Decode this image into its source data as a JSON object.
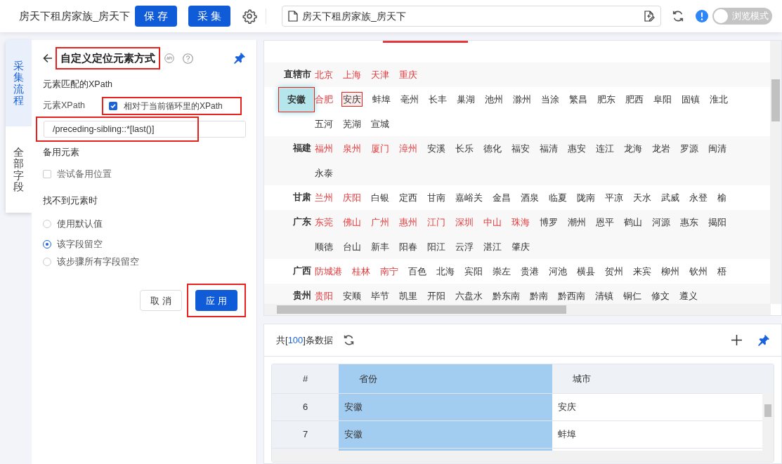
{
  "toolbar": {
    "task_name": "房天下租房家族_房天下",
    "buttons": [
      "保 存",
      "采 集"
    ],
    "url": "房天下租房家族_房天下",
    "mode_toggle": {
      "label": "浏览模式",
      "on": false
    }
  },
  "side_tabs": [
    {
      "label": "采集流程",
      "selected": true
    },
    {
      "label": "全部字段",
      "selected": false
    }
  ],
  "panel": {
    "title": "自定义定位元素方式",
    "xpath_section": "元素匹配的XPath",
    "xpath_label": "元素XPath",
    "relative": {
      "label": "相对于当前循环里的XPath",
      "checked": true
    },
    "xpath_value": "/preceding-sibling::*[last()]",
    "backup_section": "备用元素",
    "backup": {
      "label": "尝试备用位置",
      "checked": false
    },
    "missing_section": "找不到元素时",
    "missing_options": [
      {
        "label": "使用默认值",
        "selected": false
      },
      {
        "label": "该字段留空",
        "selected": true
      },
      {
        "label": "该步骤所有字段留空",
        "selected": false
      }
    ],
    "buttons": [
      "取 消",
      "应 用"
    ]
  },
  "provinces": [
    {
      "name": "直辖市",
      "selected": false,
      "lines": [
        [
          {
            "name": "北京",
            "hot": true,
            "selected": false
          },
          {
            "name": "上海",
            "hot": true,
            "selected": false
          },
          {
            "name": "天津",
            "hot": true,
            "selected": false
          },
          {
            "name": "重庆",
            "hot": true,
            "selected": false
          }
        ]
      ]
    },
    {
      "name": "安徽",
      "selected": true,
      "lines": [
        [
          {
            "name": "合肥",
            "hot": true,
            "selected": false
          },
          {
            "name": "安庆",
            "hot": false,
            "selected": true
          },
          {
            "name": "蚌埠",
            "hot": false,
            "selected": false
          },
          {
            "name": "亳州",
            "hot": false,
            "selected": false
          },
          {
            "name": "长丰",
            "hot": false,
            "selected": false
          },
          {
            "name": "巢湖",
            "hot": false,
            "selected": false
          },
          {
            "name": "池州",
            "hot": false,
            "selected": false
          },
          {
            "name": "滁州",
            "hot": false,
            "selected": false
          },
          {
            "name": "当涂",
            "hot": false,
            "selected": false
          },
          {
            "name": "繁昌",
            "hot": false,
            "selected": false
          },
          {
            "name": "肥东",
            "hot": false,
            "selected": false
          },
          {
            "name": "肥西",
            "hot": false,
            "selected": false
          },
          {
            "name": "阜阳",
            "hot": false,
            "selected": false
          },
          {
            "name": "固镇",
            "hot": false,
            "selected": false
          },
          {
            "name": "淮北",
            "hot": false,
            "selected": false
          }
        ],
        [
          {
            "name": "五河",
            "hot": false,
            "selected": false
          },
          {
            "name": "芜湖",
            "hot": false,
            "selected": false
          },
          {
            "name": "宣城",
            "hot": false,
            "selected": false
          }
        ]
      ]
    },
    {
      "name": "福建",
      "selected": false,
      "lines": [
        [
          {
            "name": "福州",
            "hot": true,
            "selected": false
          },
          {
            "name": "泉州",
            "hot": true,
            "selected": false
          },
          {
            "name": "厦门",
            "hot": true,
            "selected": false
          },
          {
            "name": "漳州",
            "hot": true,
            "selected": false
          },
          {
            "name": "安溪",
            "hot": false,
            "selected": false
          },
          {
            "name": "长乐",
            "hot": false,
            "selected": false
          },
          {
            "name": "德化",
            "hot": false,
            "selected": false
          },
          {
            "name": "福安",
            "hot": false,
            "selected": false
          },
          {
            "name": "福清",
            "hot": false,
            "selected": false
          },
          {
            "name": "惠安",
            "hot": false,
            "selected": false
          },
          {
            "name": "连江",
            "hot": false,
            "selected": false
          },
          {
            "name": "龙海",
            "hot": false,
            "selected": false
          },
          {
            "name": "龙岩",
            "hot": false,
            "selected": false
          },
          {
            "name": "罗源",
            "hot": false,
            "selected": false
          },
          {
            "name": "闽清",
            "hot": false,
            "selected": false
          }
        ],
        [
          {
            "name": "永泰",
            "hot": false,
            "selected": false
          }
        ]
      ]
    },
    {
      "name": "甘肃",
      "selected": false,
      "lines": [
        [
          {
            "name": "兰州",
            "hot": true,
            "selected": false
          },
          {
            "name": "庆阳",
            "hot": true,
            "selected": false
          },
          {
            "name": "白银",
            "hot": false,
            "selected": false
          },
          {
            "name": "定西",
            "hot": false,
            "selected": false
          },
          {
            "name": "甘南",
            "hot": false,
            "selected": false
          },
          {
            "name": "嘉峪关",
            "hot": false,
            "selected": false
          },
          {
            "name": "金昌",
            "hot": false,
            "selected": false
          },
          {
            "name": "酒泉",
            "hot": false,
            "selected": false
          },
          {
            "name": "临夏",
            "hot": false,
            "selected": false
          },
          {
            "name": "陇南",
            "hot": false,
            "selected": false
          },
          {
            "name": "平凉",
            "hot": false,
            "selected": false
          },
          {
            "name": "天水",
            "hot": false,
            "selected": false
          },
          {
            "name": "武威",
            "hot": false,
            "selected": false
          },
          {
            "name": "永登",
            "hot": false,
            "selected": false
          },
          {
            "name": "榆",
            "hot": false,
            "selected": false
          }
        ]
      ]
    },
    {
      "name": "广东",
      "selected": false,
      "lines": [
        [
          {
            "name": "东莞",
            "hot": true,
            "selected": false
          },
          {
            "name": "佛山",
            "hot": true,
            "selected": false
          },
          {
            "name": "广州",
            "hot": true,
            "selected": false
          },
          {
            "name": "惠州",
            "hot": true,
            "selected": false
          },
          {
            "name": "江门",
            "hot": true,
            "selected": false
          },
          {
            "name": "深圳",
            "hot": true,
            "selected": false
          },
          {
            "name": "中山",
            "hot": true,
            "selected": false
          },
          {
            "name": "珠海",
            "hot": true,
            "selected": false
          },
          {
            "name": "博罗",
            "hot": false,
            "selected": false
          },
          {
            "name": "潮州",
            "hot": false,
            "selected": false
          },
          {
            "name": "恩平",
            "hot": false,
            "selected": false
          },
          {
            "name": "鹤山",
            "hot": false,
            "selected": false
          },
          {
            "name": "河源",
            "hot": false,
            "selected": false
          },
          {
            "name": "惠东",
            "hot": false,
            "selected": false
          },
          {
            "name": "揭阳",
            "hot": false,
            "selected": false
          }
        ],
        [
          {
            "name": "顺德",
            "hot": false,
            "selected": false
          },
          {
            "name": "台山",
            "hot": false,
            "selected": false
          },
          {
            "name": "新丰",
            "hot": false,
            "selected": false
          },
          {
            "name": "阳春",
            "hot": false,
            "selected": false
          },
          {
            "name": "阳江",
            "hot": false,
            "selected": false
          },
          {
            "name": "云浮",
            "hot": false,
            "selected": false
          },
          {
            "name": "湛江",
            "hot": false,
            "selected": false
          },
          {
            "name": "肇庆",
            "hot": false,
            "selected": false
          }
        ]
      ]
    },
    {
      "name": "广西",
      "selected": false,
      "lines": [
        [
          {
            "name": "防城港",
            "hot": true,
            "selected": false
          },
          {
            "name": "桂林",
            "hot": true,
            "selected": false
          },
          {
            "name": "南宁",
            "hot": true,
            "selected": false
          },
          {
            "name": "百色",
            "hot": false,
            "selected": false
          },
          {
            "name": "北海",
            "hot": false,
            "selected": false
          },
          {
            "name": "宾阳",
            "hot": false,
            "selected": false
          },
          {
            "name": "崇左",
            "hot": false,
            "selected": false
          },
          {
            "name": "贵港",
            "hot": false,
            "selected": false
          },
          {
            "name": "河池",
            "hot": false,
            "selected": false
          },
          {
            "name": "横县",
            "hot": false,
            "selected": false
          },
          {
            "name": "贺州",
            "hot": false,
            "selected": false
          },
          {
            "name": "来宾",
            "hot": false,
            "selected": false
          },
          {
            "name": "柳州",
            "hot": false,
            "selected": false
          },
          {
            "name": "钦州",
            "hot": false,
            "selected": false
          },
          {
            "name": "梧",
            "hot": false,
            "selected": false
          }
        ]
      ]
    },
    {
      "name": "贵州",
      "selected": false,
      "lines": [
        [
          {
            "name": "贵阳",
            "hot": true,
            "selected": false
          },
          {
            "name": "安顺",
            "hot": false,
            "selected": false
          },
          {
            "name": "毕节",
            "hot": false,
            "selected": false
          },
          {
            "name": "凯里",
            "hot": false,
            "selected": false
          },
          {
            "name": "开阳",
            "hot": false,
            "selected": false
          },
          {
            "name": "六盘水",
            "hot": false,
            "selected": false
          },
          {
            "name": "黔东南",
            "hot": false,
            "selected": false
          },
          {
            "name": "黔南",
            "hot": false,
            "selected": false
          },
          {
            "name": "黔西南",
            "hot": false,
            "selected": false
          },
          {
            "name": "清镇",
            "hot": false,
            "selected": false
          },
          {
            "name": "铜仁",
            "hot": false,
            "selected": false
          },
          {
            "name": "修文",
            "hot": false,
            "selected": false
          },
          {
            "name": "遵义",
            "hot": false,
            "selected": false
          }
        ]
      ]
    }
  ],
  "data_panel": {
    "count_prefix": "共[",
    "count": "100",
    "count_suffix": "]条数据",
    "table": {
      "columns": [
        {
          "label": "#",
          "selected": false
        },
        {
          "label": "省份",
          "selected": true
        },
        {
          "label": "城市",
          "selected": false
        }
      ],
      "rows": [
        [
          "6",
          "安徽",
          "安庆"
        ],
        [
          "7",
          "安徽",
          "蚌埠"
        ]
      ]
    }
  }
}
